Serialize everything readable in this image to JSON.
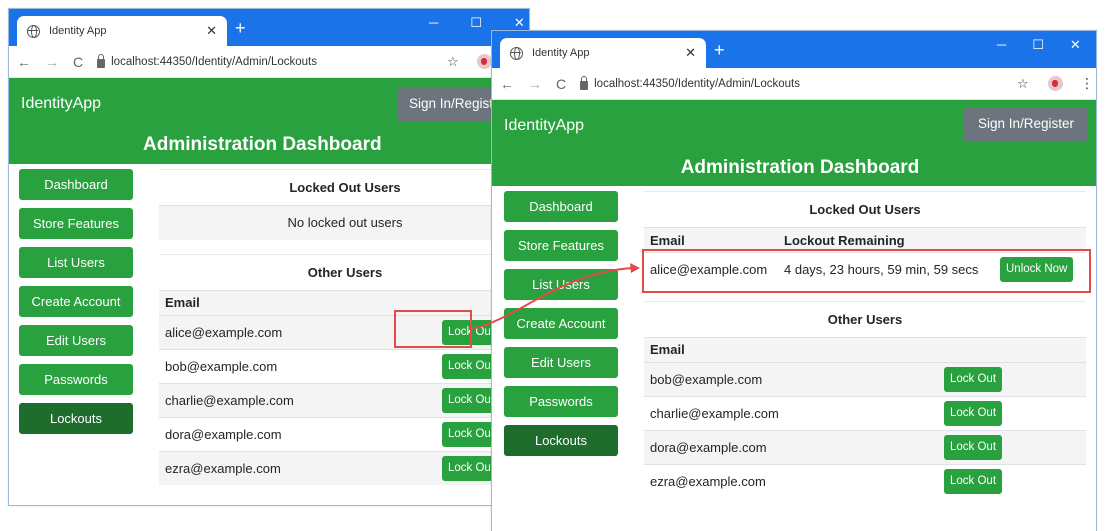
{
  "colors": {
    "brand_green": "#2aa13f",
    "active_green": "#1e6d2d",
    "chrome_blue": "#1a73e8",
    "highlight_red": "#e34a4a"
  },
  "browser": {
    "tab_title": "Identity App",
    "url_host": "localhost",
    "url_port": ":44350",
    "url_path": "/Identity/Admin/Lockouts"
  },
  "app": {
    "brand": "IdentityApp",
    "sign_in_label": "Sign In/Register",
    "dashboard_title": "Administration Dashboard",
    "sidebar": [
      "Dashboard",
      "Store Features",
      "List Users",
      "Create Account",
      "Edit Users",
      "Passwords",
      "Lockouts"
    ],
    "active_sidebar_item": "Lockouts"
  },
  "window_before": {
    "locked_out_title": "Locked Out Users",
    "no_locked_message": "No locked out users",
    "other_users_title": "Other Users",
    "email_header": "Email",
    "lock_out_label": "Lock Out",
    "users": [
      "alice@example.com",
      "bob@example.com",
      "charlie@example.com",
      "dora@example.com",
      "ezra@example.com"
    ]
  },
  "window_after": {
    "locked_out_title": "Locked Out Users",
    "email_header": "Email",
    "remaining_header": "Lockout Remaining",
    "locked_users": [
      {
        "email": "alice@example.com",
        "remaining": "4 days, 23 hours, 59 min, 59 secs",
        "unlock_label": "Unlock Now"
      }
    ],
    "other_users_title": "Other Users",
    "lock_out_label": "Lock Out",
    "users": [
      "bob@example.com",
      "charlie@example.com",
      "dora@example.com",
      "ezra@example.com"
    ]
  }
}
